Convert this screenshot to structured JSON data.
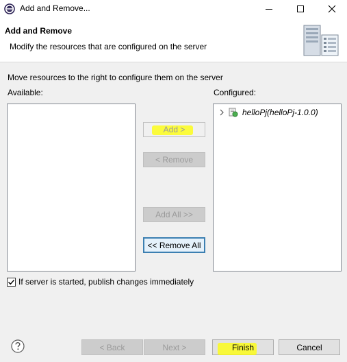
{
  "window": {
    "title": "Add and Remove...",
    "controls": {
      "minimize": "minimize",
      "maximize": "maximize",
      "close": "close"
    }
  },
  "header": {
    "title": "Add and Remove",
    "description": "Modify the resources that are configured on the server",
    "graphic_icon": "server-icon"
  },
  "body": {
    "instruction": "Move resources to the right to configure them on the server",
    "available_label": "Available:",
    "configured_label": "Configured:",
    "available_items": [],
    "configured_items": [
      {
        "label": "helloPj(helloPj-1.0.0)",
        "expanded": false,
        "icon": "web-project-icon"
      }
    ]
  },
  "buttons": {
    "add": "Add >",
    "remove": "< Remove",
    "add_all": "Add All >>",
    "remove_all": "<< Remove All"
  },
  "checkbox": {
    "label": "If server is started, publish changes immediately",
    "checked": true
  },
  "footer": {
    "help_icon": "help-icon",
    "back": "< Back",
    "next": "Next >",
    "finish": "Finish",
    "cancel": "Cancel"
  },
  "colors": {
    "highlight": "#ffff00",
    "focus_border": "#3c7fb1",
    "disabled_text": "#9a9a9a"
  }
}
